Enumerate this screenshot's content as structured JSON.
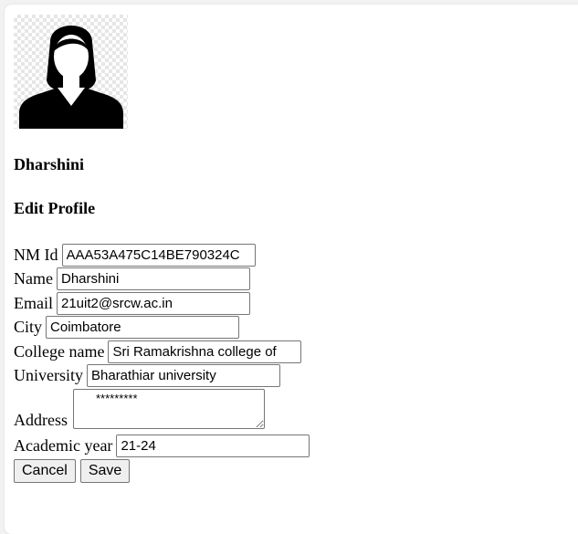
{
  "profile": {
    "name": "Dharshini",
    "avatar_icon": "female-user-avatar-icon"
  },
  "headings": {
    "edit_profile": "Edit Profile"
  },
  "form": {
    "nm_id": {
      "label": "NM Id",
      "value": "AAA53A475C14BE790324C"
    },
    "name": {
      "label": "Name",
      "value": "Dharshini"
    },
    "email": {
      "label": "Email",
      "value": "21uit2@srcw.ac.in"
    },
    "city": {
      "label": "City",
      "value": "Coimbatore"
    },
    "college": {
      "label": "College name",
      "value": "Sri Ramakrishna college of"
    },
    "university": {
      "label": "University",
      "value": "Bharathiar university"
    },
    "address": {
      "label": "Address",
      "value": "*********"
    },
    "academic_year": {
      "label": "Academic year",
      "value": "21-24"
    }
  },
  "buttons": {
    "cancel": "Cancel",
    "save": "Save"
  }
}
